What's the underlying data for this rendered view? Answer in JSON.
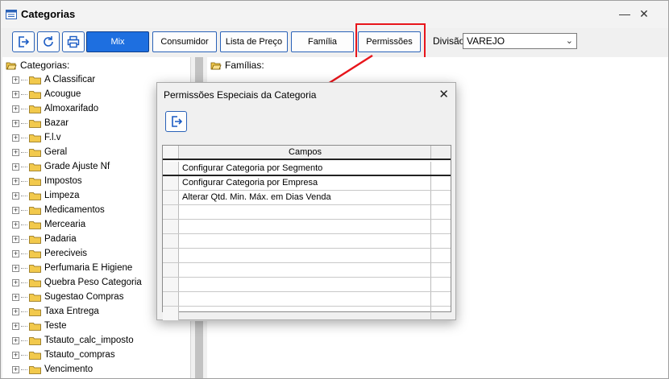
{
  "window": {
    "title": "Categorias"
  },
  "toolbar": {
    "tabs": [
      "Mix",
      "Consumidor",
      "Lista de Preço",
      "Família",
      "Permissões"
    ],
    "divisao_label": "Divisão",
    "divisao_value": "VAREJO"
  },
  "tree": {
    "root_label": "Categorias:",
    "items": [
      " A Classificar",
      "Acougue",
      "Almoxarifado",
      "Bazar",
      "F.l.v",
      "Geral",
      "Grade Ajuste Nf",
      "Impostos",
      "Limpeza",
      "Medicamentos",
      "Mercearia",
      "Padaria",
      "Pereciveis",
      "Perfumaria E Higiene",
      "Quebra Peso Categoria",
      "Sugestao Compras",
      "Taxa Entrega",
      "Teste",
      "Tstauto_calc_imposto",
      "Tstauto_compras",
      "Vencimento"
    ]
  },
  "families": {
    "label": "Famílias:"
  },
  "dialog": {
    "title": "Permissões Especiais da Categoria",
    "grid": {
      "header": "Campos",
      "rows": [
        "Configurar Categoria por Segmento",
        "Configurar Categoria por Empresa",
        "Alterar Qtd. Min. Máx. em Dias Venda",
        "",
        "",
        "",
        "",
        "",
        "",
        "",
        ""
      ]
    }
  },
  "colors": {
    "accent": "#1e6fe0",
    "highlight": "#e8151b",
    "folder": "#f2c94c"
  }
}
